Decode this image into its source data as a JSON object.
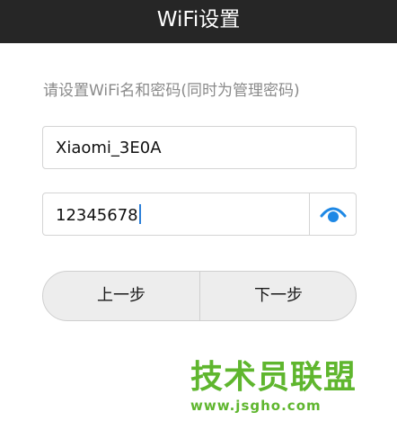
{
  "header": {
    "title": "WiFi设置"
  },
  "instruction": "请设置WiFi名和密码(同时为管理密码)",
  "ssid_field": {
    "value": "Xiaomi_3E0A"
  },
  "password_field": {
    "value": "12345678",
    "toggle_icon": "eye-icon",
    "icon_color": "#1e88e5"
  },
  "buttons": {
    "prev_label": "上一步",
    "next_label": "下一步"
  },
  "watermark": {
    "text": "技术员联盟",
    "url": "www.jsgho.com",
    "color": "#5fb62e"
  },
  "colors": {
    "titlebar": "#262626",
    "accent": "#1e88e5"
  }
}
